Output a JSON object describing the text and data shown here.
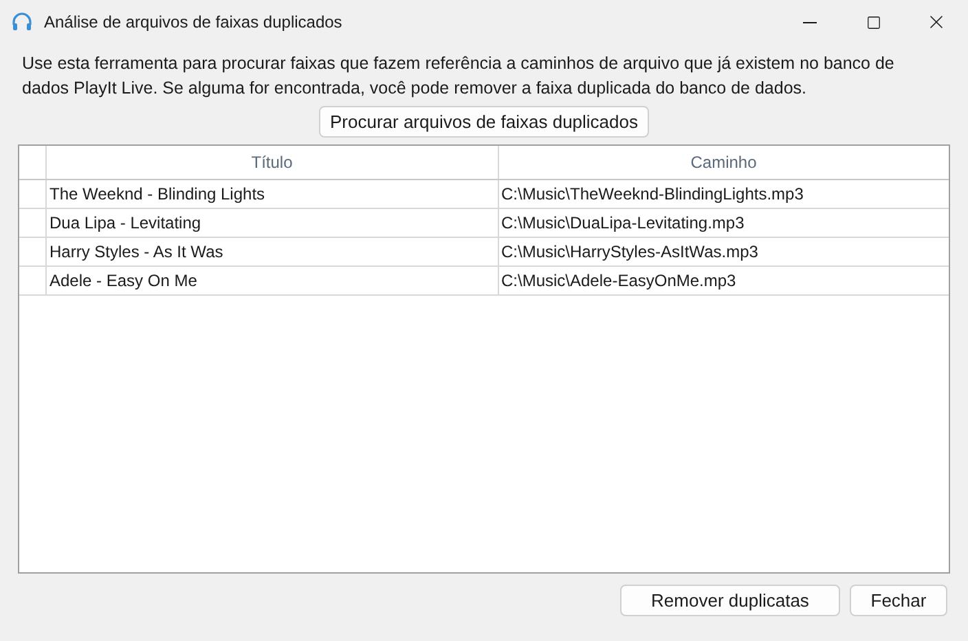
{
  "window": {
    "title": "Análise de arquivos de faixas duplicados"
  },
  "description": "Use esta ferramenta para procurar faixas que fazem referência a caminhos de arquivo que já existem no banco de dados PlayIt Live. Se alguma for encontrada, você pode remover a faixa duplicada do banco de dados.",
  "search_button": "Procurar arquivos de faixas duplicados",
  "table": {
    "columns": [
      "Título",
      "Caminho"
    ],
    "rows": [
      [
        "The Weeknd - Blinding Lights",
        "C:\\Music\\TheWeeknd-BlindingLights.mp3"
      ],
      [
        "Dua Lipa - Levitating",
        "C:\\Music\\DuaLipa-Levitating.mp3"
      ],
      [
        "Harry Styles - As It Was",
        "C:\\Music\\HarryStyles-AsItWas.mp3"
      ],
      [
        "Adele - Easy On Me",
        "C:\\Music\\Adele-EasyOnMe.mp3"
      ]
    ]
  },
  "buttons": [
    "Remover duplicatas",
    "Fechar"
  ]
}
